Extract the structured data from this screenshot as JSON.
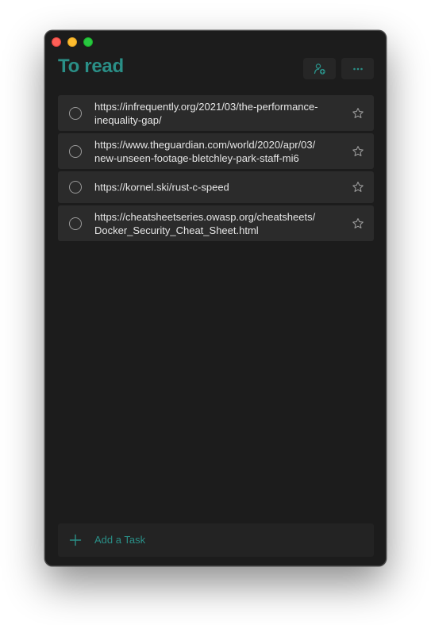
{
  "window": {
    "title": "To read"
  },
  "header": {
    "share_icon": "person-add-icon",
    "more_icon": "ellipsis-icon"
  },
  "tasks": [
    {
      "line1": "https://infrequently.org/2021/03/the-performance-",
      "line2": "inequality-gap/",
      "completed": false,
      "important": false
    },
    {
      "line1": "https://www.theguardian.com/world/2020/apr/03/",
      "line2": "new-unseen-footage-bletchley-park-staff-mi6",
      "completed": false,
      "important": false
    },
    {
      "line1": "https://kornel.ski/rust-c-speed",
      "line2": "",
      "completed": false,
      "important": false
    },
    {
      "line1": "https://cheatsheetseries.owasp.org/cheatsheets/",
      "line2": "Docker_Security_Cheat_Sheet.html",
      "completed": false,
      "important": false
    }
  ],
  "add_task": {
    "label": "Add a Task",
    "icon": "plus-icon"
  },
  "colors": {
    "accent": "#2a8f87",
    "background": "#1c1c1c",
    "task_background": "#2b2b2b",
    "text": "#e6e6e6"
  }
}
